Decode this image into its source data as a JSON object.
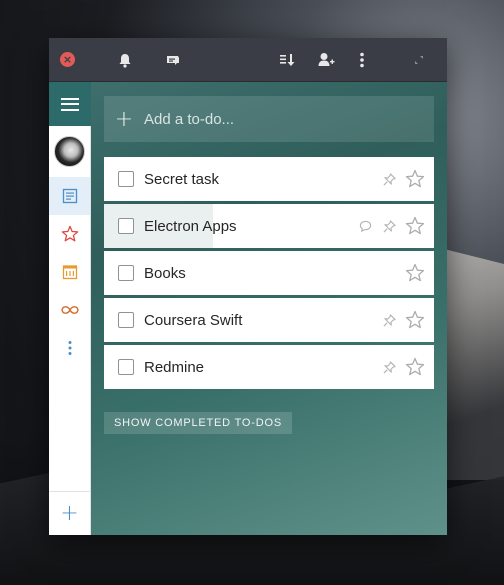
{
  "titlebar": {
    "close_label": "×",
    "icons": [
      "bell-icon",
      "conversation-icon",
      "sort-icon",
      "add-person-icon",
      "more-icon",
      "resize-icon"
    ]
  },
  "sidebar": {
    "items": [
      {
        "name": "inbox-list",
        "icon": "inbox-icon",
        "color": "#4a8fc8"
      },
      {
        "name": "starred-list",
        "icon": "star-icon",
        "color": "#e0453f"
      },
      {
        "name": "today-list",
        "icon": "calendar-icon",
        "color": "#e89a2c"
      },
      {
        "name": "week-list",
        "icon": "infinity-icon",
        "color": "#d36b2d"
      },
      {
        "name": "more-lists",
        "icon": "more-vertical-icon",
        "color": "#4a8fc8"
      }
    ],
    "add_label": "+"
  },
  "add_todo": {
    "plus": "+",
    "placeholder": "Add a to-do..."
  },
  "tasks": [
    {
      "title": "Secret task",
      "pinned": true,
      "comment": false
    },
    {
      "title": "Electron Apps",
      "pinned": true,
      "comment": true
    },
    {
      "title": "Books",
      "pinned": false,
      "comment": false
    },
    {
      "title": "Coursera Swift",
      "pinned": true,
      "comment": false
    },
    {
      "title": "Redmine",
      "pinned": true,
      "comment": false
    }
  ],
  "show_completed_label": "SHOW COMPLETED TO-DOS",
  "colors": {
    "accent": "#2d6b6a",
    "titlebar": "#3a3d46",
    "close": "#e25b57"
  }
}
